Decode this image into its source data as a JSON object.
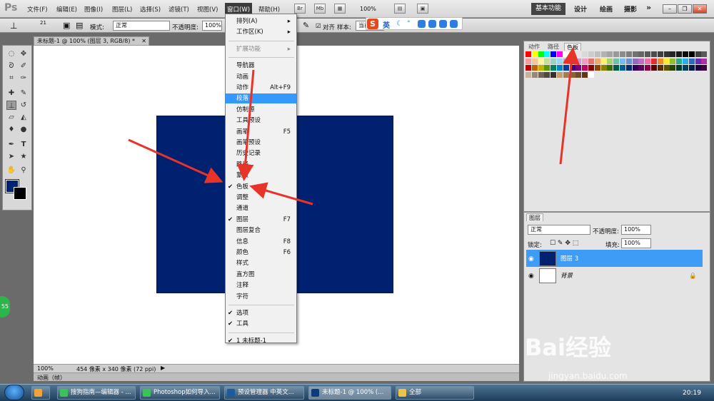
{
  "app": {
    "logo": "Ps"
  },
  "menus": [
    "文件(F)",
    "编辑(E)",
    "图像(I)",
    "图层(L)",
    "选择(S)",
    "滤镜(T)",
    "视图(V)",
    "窗口(W)",
    "帮助(H)"
  ],
  "topbar": {
    "zoom": "100%",
    "icons": [
      "Br",
      "Mb"
    ],
    "workspaces": [
      "基本功能",
      "设计",
      "绘画",
      "摄影"
    ],
    "more": "»"
  },
  "options": {
    "brush_size": "21",
    "mode_label": "模式:",
    "mode_value": "正常",
    "opacity_label": "不透明度:",
    "opacity_value": "100%",
    "align_label": "对齐",
    "sample_label": "样本:",
    "sample_value": "当前"
  },
  "ime": {
    "logo": "S",
    "mode": "英"
  },
  "document": {
    "tab_title": "未标题-1 @ 100% (图层 3, RGB/8) *",
    "zoom": "100%",
    "size_info": "454 像素 x 340 像素 (72 ppi)",
    "fill_color": "#002070"
  },
  "animation_bar": {
    "label": "动画（帧）"
  },
  "window_menu": {
    "items": [
      {
        "label": "排列(A)",
        "shortcut": "",
        "submenu": true,
        "checked": false,
        "disabled": false,
        "highlighted": false
      },
      {
        "label": "工作区(K)",
        "shortcut": "",
        "submenu": true,
        "checked": false,
        "disabled": false,
        "highlighted": false
      },
      {
        "label": "扩展功能",
        "shortcut": "",
        "submenu": true,
        "checked": false,
        "disabled": true,
        "highlighted": false
      },
      {
        "label": "导航器",
        "shortcut": "",
        "submenu": false,
        "checked": false,
        "disabled": false,
        "highlighted": false
      },
      {
        "label": "动画",
        "shortcut": "",
        "submenu": false,
        "checked": false,
        "disabled": false,
        "highlighted": false
      },
      {
        "label": "动作",
        "shortcut": "Alt+F9",
        "submenu": false,
        "checked": false,
        "disabled": false,
        "highlighted": false
      },
      {
        "label": "段落",
        "shortcut": "",
        "submenu": false,
        "checked": false,
        "disabled": false,
        "highlighted": true
      },
      {
        "label": "仿制源",
        "shortcut": "",
        "submenu": false,
        "checked": false,
        "disabled": false,
        "highlighted": false
      },
      {
        "label": "工具预设",
        "shortcut": "",
        "submenu": false,
        "checked": false,
        "disabled": false,
        "highlighted": false
      },
      {
        "label": "画笔",
        "shortcut": "F5",
        "submenu": false,
        "checked": false,
        "disabled": false,
        "highlighted": false
      },
      {
        "label": "画笔预设",
        "shortcut": "",
        "submenu": false,
        "checked": false,
        "disabled": false,
        "highlighted": false
      },
      {
        "label": "历史记录",
        "shortcut": "",
        "submenu": false,
        "checked": false,
        "disabled": false,
        "highlighted": false
      },
      {
        "label": "路径",
        "shortcut": "",
        "submenu": false,
        "checked": false,
        "disabled": false,
        "highlighted": false
      },
      {
        "label": "蒙版",
        "shortcut": "",
        "submenu": false,
        "checked": false,
        "disabled": false,
        "highlighted": false
      },
      {
        "label": "色板",
        "shortcut": "",
        "submenu": false,
        "checked": true,
        "disabled": false,
        "highlighted": false
      },
      {
        "label": "调整",
        "shortcut": "",
        "submenu": false,
        "checked": false,
        "disabled": false,
        "highlighted": false
      },
      {
        "label": "通道",
        "shortcut": "",
        "submenu": false,
        "checked": false,
        "disabled": false,
        "highlighted": false
      },
      {
        "label": "图层",
        "shortcut": "F7",
        "submenu": false,
        "checked": true,
        "disabled": false,
        "highlighted": false
      },
      {
        "label": "图层复合",
        "shortcut": "",
        "submenu": false,
        "checked": false,
        "disabled": false,
        "highlighted": false
      },
      {
        "label": "信息",
        "shortcut": "F8",
        "submenu": false,
        "checked": false,
        "disabled": false,
        "highlighted": false
      },
      {
        "label": "颜色",
        "shortcut": "F6",
        "submenu": false,
        "checked": false,
        "disabled": false,
        "highlighted": false
      },
      {
        "label": "样式",
        "shortcut": "",
        "submenu": false,
        "checked": false,
        "disabled": false,
        "highlighted": false
      },
      {
        "label": "直方图",
        "shortcut": "",
        "submenu": false,
        "checked": false,
        "disabled": false,
        "highlighted": false
      },
      {
        "label": "注释",
        "shortcut": "",
        "submenu": false,
        "checked": false,
        "disabled": false,
        "highlighted": false
      },
      {
        "label": "字符",
        "shortcut": "",
        "submenu": false,
        "checked": false,
        "disabled": false,
        "highlighted": false
      },
      {
        "label": "选项",
        "shortcut": "",
        "submenu": false,
        "checked": true,
        "disabled": false,
        "highlighted": false
      },
      {
        "label": "工具",
        "shortcut": "",
        "submenu": false,
        "checked": true,
        "disabled": false,
        "highlighted": false
      },
      {
        "label": "1 未标题-1",
        "shortcut": "",
        "submenu": false,
        "checked": true,
        "disabled": false,
        "highlighted": false
      }
    ],
    "check_glyph": "✔"
  },
  "swatch_panel": {
    "tabs": [
      "动作",
      "路径",
      "色板"
    ],
    "active_tab": "色板"
  },
  "layers_panel": {
    "title": "图层",
    "blend_mode": "正常",
    "opacity_label": "不透明度:",
    "opacity_value": "100%",
    "lock_label": "锁定:",
    "fill_label": "填充:",
    "fill_value": "100%",
    "layers": [
      {
        "name": "图层 3",
        "selected": true,
        "thumb": "#002070"
      },
      {
        "name": "背景",
        "selected": false,
        "thumb": "#ffffff"
      }
    ]
  },
  "taskbar": {
    "items": [
      "搜狗指南—编辑器 - ...",
      "Photoshop如何导入...",
      "预设管理器 中英文...",
      "未标题-1 @ 100% (...",
      "全部"
    ],
    "clock": "20:19"
  },
  "watermark": {
    "brand": "Bai经验",
    "url": "jingyan.baidu.com"
  },
  "side_badge": "55"
}
